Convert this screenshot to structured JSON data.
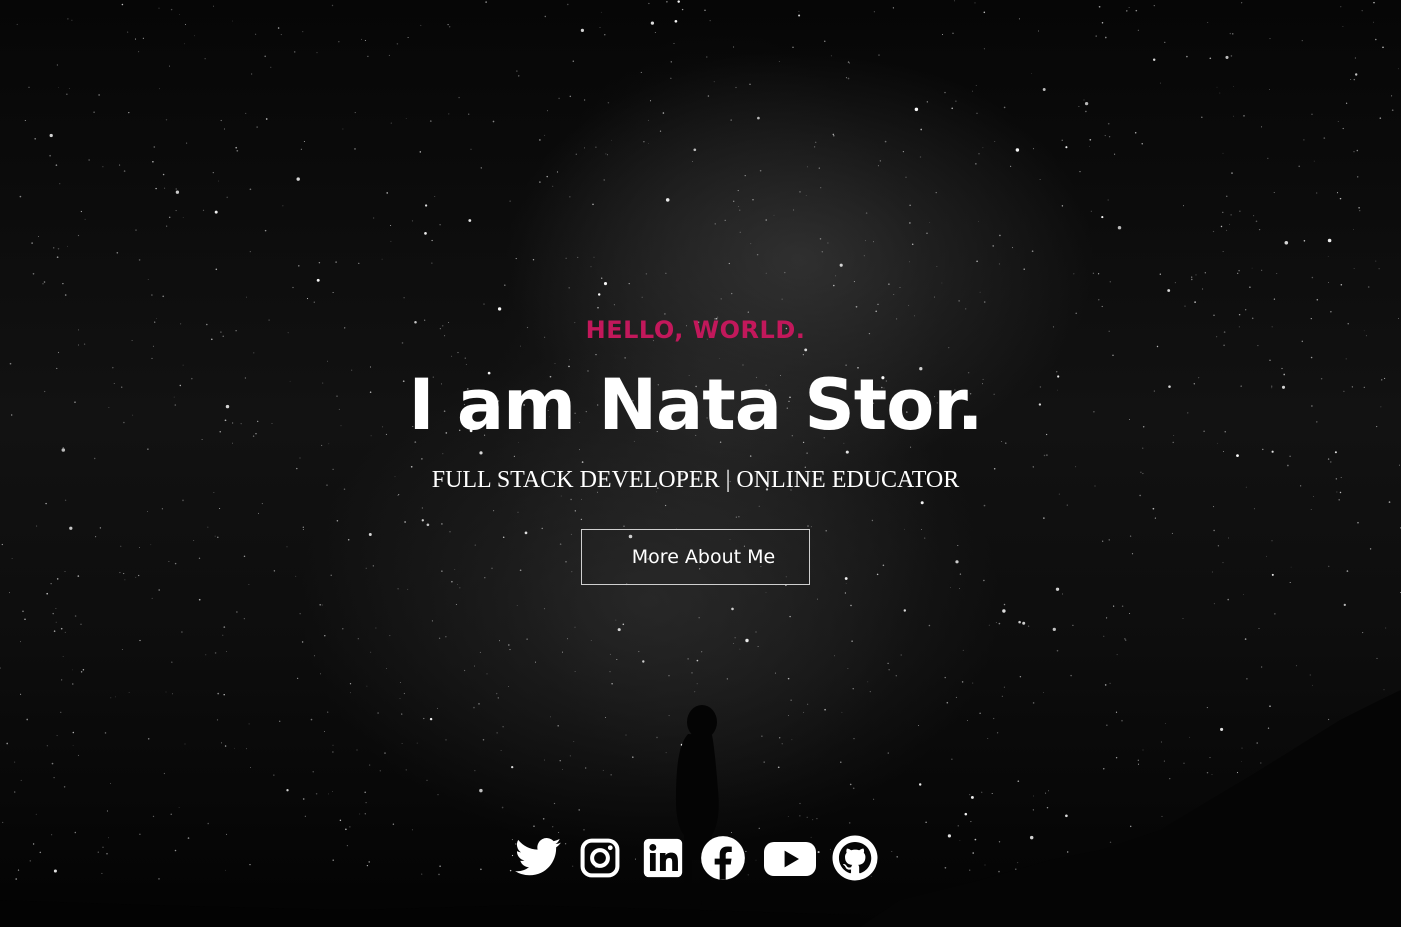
{
  "hero": {
    "greeting": "HELLO, WORLD.",
    "name": "I am Nata Stor.",
    "subtitle": "FULL STACK DEVELOPER | ONLINE EDUCATOR",
    "cta_label": "More About Me"
  },
  "social_links": [
    {
      "icon": "twitter-icon"
    },
    {
      "icon": "instagram-icon"
    },
    {
      "icon": "linkedin-icon"
    },
    {
      "icon": "facebook-icon"
    },
    {
      "icon": "youtube-icon"
    },
    {
      "icon": "github-icon"
    }
  ],
  "colors": {
    "accent": "#c2185b",
    "text": "#ffffff",
    "background": "#050505"
  }
}
